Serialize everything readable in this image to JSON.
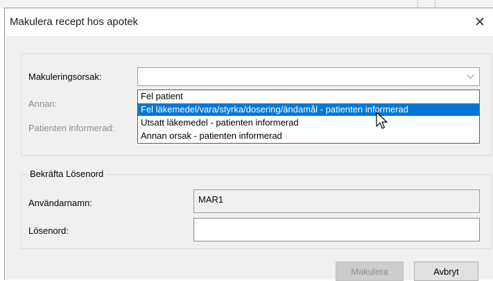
{
  "dialog": {
    "title": "Makulera recept hos apotek",
    "close_glyph": "✕"
  },
  "reason": {
    "label": "Makuleringsorsak:",
    "value": "",
    "chevron_glyph": "⌵",
    "options": [
      "Fel patient",
      "Fel läkemedel/vara/styrka/dosering/ändamål - patienten informerad",
      "Utsatt läkemedel - patienten informerad",
      "Annan orsak - patienten informerad"
    ],
    "highlighted_index": 1
  },
  "other": {
    "label": "Annan:"
  },
  "informed": {
    "label": "Patienten informerad:"
  },
  "confirm": {
    "legend": "Bekräfta Lösenord",
    "username_label": "Användarnamn:",
    "username_value": "MAR1",
    "password_label": "Lösenord:",
    "password_value": ""
  },
  "buttons": {
    "makulera": "Makulera",
    "avbryt": "Avbryt"
  },
  "colors": {
    "selection": "#0078d7",
    "combo_border": "#6fa7d9"
  },
  "icons": {
    "close": "close-icon",
    "dropdown": "chevron-down-icon",
    "cursor": "mouse-pointer-icon"
  }
}
